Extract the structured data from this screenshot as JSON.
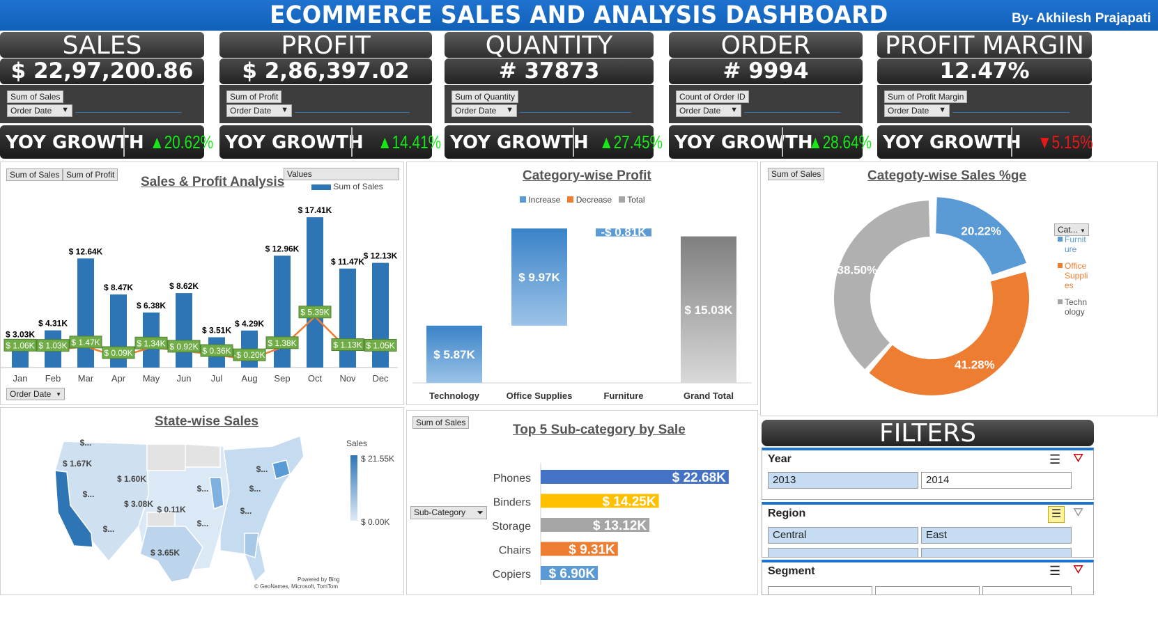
{
  "header": {
    "title": "ECOMMERCE SALES AND ANALYSIS DASHBOARD",
    "by": "By- Akhilesh Prajapati"
  },
  "kpis": [
    {
      "title": "SALES",
      "value": "$  22,97,200.86",
      "field": "Sum of Sales",
      "filter": "Order Date",
      "yoy_label": "YOY GROWTH",
      "yoy": "20.62%",
      "trend": "up",
      "color": "#18e818"
    },
    {
      "title": "PROFIT",
      "value": "$  2,86,397.02",
      "field": "Sum of Profit",
      "filter": "Order Date",
      "yoy_label": "YOY GROWTH",
      "yoy": "14.41%",
      "trend": "up",
      "color": "#18e818"
    },
    {
      "title": "QUANTITY",
      "value": "# 37873",
      "field": "Sum of Quantity",
      "filter": "Order Date",
      "yoy_label": "YOY GROWTH",
      "yoy": "27.45%",
      "trend": "up",
      "color": "#18e818"
    },
    {
      "title": "ORDER",
      "value": "# 9994",
      "field": "Count of Order ID",
      "filter": "Order Date",
      "yoy_label": "YOY GROWTH",
      "yoy": "28.64%",
      "trend": "up",
      "color": "#18e818"
    },
    {
      "title": "PROFIT MARGIN",
      "value": "12.47%",
      "field": "Sum of Profit Margin",
      "filter": "Order Date",
      "yoy_label": "YOY GROWTH",
      "yoy": "5.15%",
      "trend": "down",
      "color": "#e81818"
    }
  ],
  "sales_profit": {
    "title": "Sales & Profit Analysis",
    "pills": [
      "Sum of Sales",
      "Sum of Profit"
    ],
    "values_pill": "Values",
    "legend": "Sum of Sales",
    "filter": "Order Date"
  },
  "category_profit": {
    "title": "Category-wise Profit",
    "legend": [
      "Increase",
      "Decrease",
      "Total"
    ]
  },
  "category_sales": {
    "title": "Categoty-wise Sales %ge",
    "pill": "Sum of Sales",
    "legend_header": "Cat...",
    "legend": [
      {
        "name": "Furnit ure",
        "color": "#5b9bd5"
      },
      {
        "name": "Office Suppli es",
        "color": "#ed7d31"
      },
      {
        "name": "Techn ology",
        "color": "#a5a5a5"
      }
    ]
  },
  "state_sales": {
    "title": "State-wise Sales",
    "legend_title": "Sales",
    "max_label": "$ 21.55K",
    "min_label": "$ 0.00K",
    "credit1": "Powered by Bing",
    "credit2": "© GeoNames, Microsoft, TomTom",
    "labels": [
      "$...",
      "$ 1.67K",
      "$ 1.60K",
      "$...",
      "$ 3.08K",
      "$ 0.11K",
      "$...",
      "$ 3.65K",
      "$...",
      "$...",
      "$...",
      "$...",
      "$..."
    ]
  },
  "top5": {
    "title": "Top 5 Sub-category by Sale",
    "pill": "Sum of Sales",
    "filter": "Sub-Category"
  },
  "filters": {
    "title": "FILTERS",
    "year": {
      "label": "Year",
      "options": [
        "2013",
        "2014"
      ]
    },
    "region": {
      "label": "Region",
      "options": [
        "Central",
        "East"
      ]
    },
    "segment": {
      "label": "Segment"
    }
  },
  "chart_data": [
    {
      "type": "bar",
      "title": "Sales & Profit Analysis",
      "categories": [
        "Jan",
        "Feb",
        "Mar",
        "Apr",
        "May",
        "Jun",
        "Jul",
        "Aug",
        "Sep",
        "Oct",
        "Nov",
        "Dec"
      ],
      "series": [
        {
          "name": "Sum of Sales",
          "values": [
            3.03,
            4.31,
            12.64,
            8.47,
            6.38,
            8.62,
            3.51,
            4.29,
            12.96,
            17.41,
            11.47,
            12.13
          ],
          "labels": [
            "$ 3.03K",
            "$ 4.31K",
            "$ 12.64K",
            "$ 8.47K",
            "$ 6.38K",
            "$ 8.62K",
            "$ 3.51K",
            "$ 4.29K",
            "$ 12.96K",
            "$ 17.41K",
            "$ 11.47K",
            "$ 12.13K"
          ]
        },
        {
          "name": "Sum of Profit",
          "values": [
            1.06,
            1.03,
            1.47,
            0.09,
            1.34,
            0.92,
            0.36,
            -0.2,
            1.38,
            5.39,
            1.13,
            1.05
          ],
          "labels": [
            "$ 1.06K",
            "$ 1.03K",
            "$ 1.47K",
            "$ 0.09K",
            "$ 1.34K",
            "$ 0.92K",
            "$ 0.36K",
            "-$ 0.20K",
            "$ 1.38K",
            "$ 5.39K",
            "$ 1.13K",
            "$ 1.05K"
          ]
        }
      ]
    },
    {
      "type": "bar",
      "title": "Category-wise Profit",
      "categories": [
        "Technology",
        "Office Supplies",
        "Furniture",
        "Grand Total"
      ],
      "values": [
        5.87,
        9.97,
        -0.81,
        15.03
      ],
      "labels": [
        "$ 5.87K",
        "$ 9.97K",
        "-$ 0.81K",
        "$ 15.03K"
      ]
    },
    {
      "type": "pie",
      "title": "Categoty-wise Sales %ge",
      "categories": [
        "Furniture",
        "Office Supplies",
        "Technology"
      ],
      "values": [
        20.22,
        41.28,
        38.5
      ],
      "labels": [
        "20.22%",
        "41.28%",
        "38.50%"
      ]
    },
    {
      "type": "bar",
      "title": "Top 5 Sub-category by Sale",
      "categories": [
        "Phones",
        "Binders",
        "Storage",
        "Chairs",
        "Copiers"
      ],
      "values": [
        22.68,
        14.25,
        13.12,
        9.31,
        6.9
      ],
      "labels": [
        "$ 22.68K",
        "$ 14.25K",
        "$ 13.12K",
        "$ 9.31K",
        "$ 6.90K"
      ],
      "colors": [
        "#4472c4",
        "#ffc000",
        "#a5a5a5",
        "#ed7d31",
        "#5b9bd5"
      ]
    }
  ]
}
